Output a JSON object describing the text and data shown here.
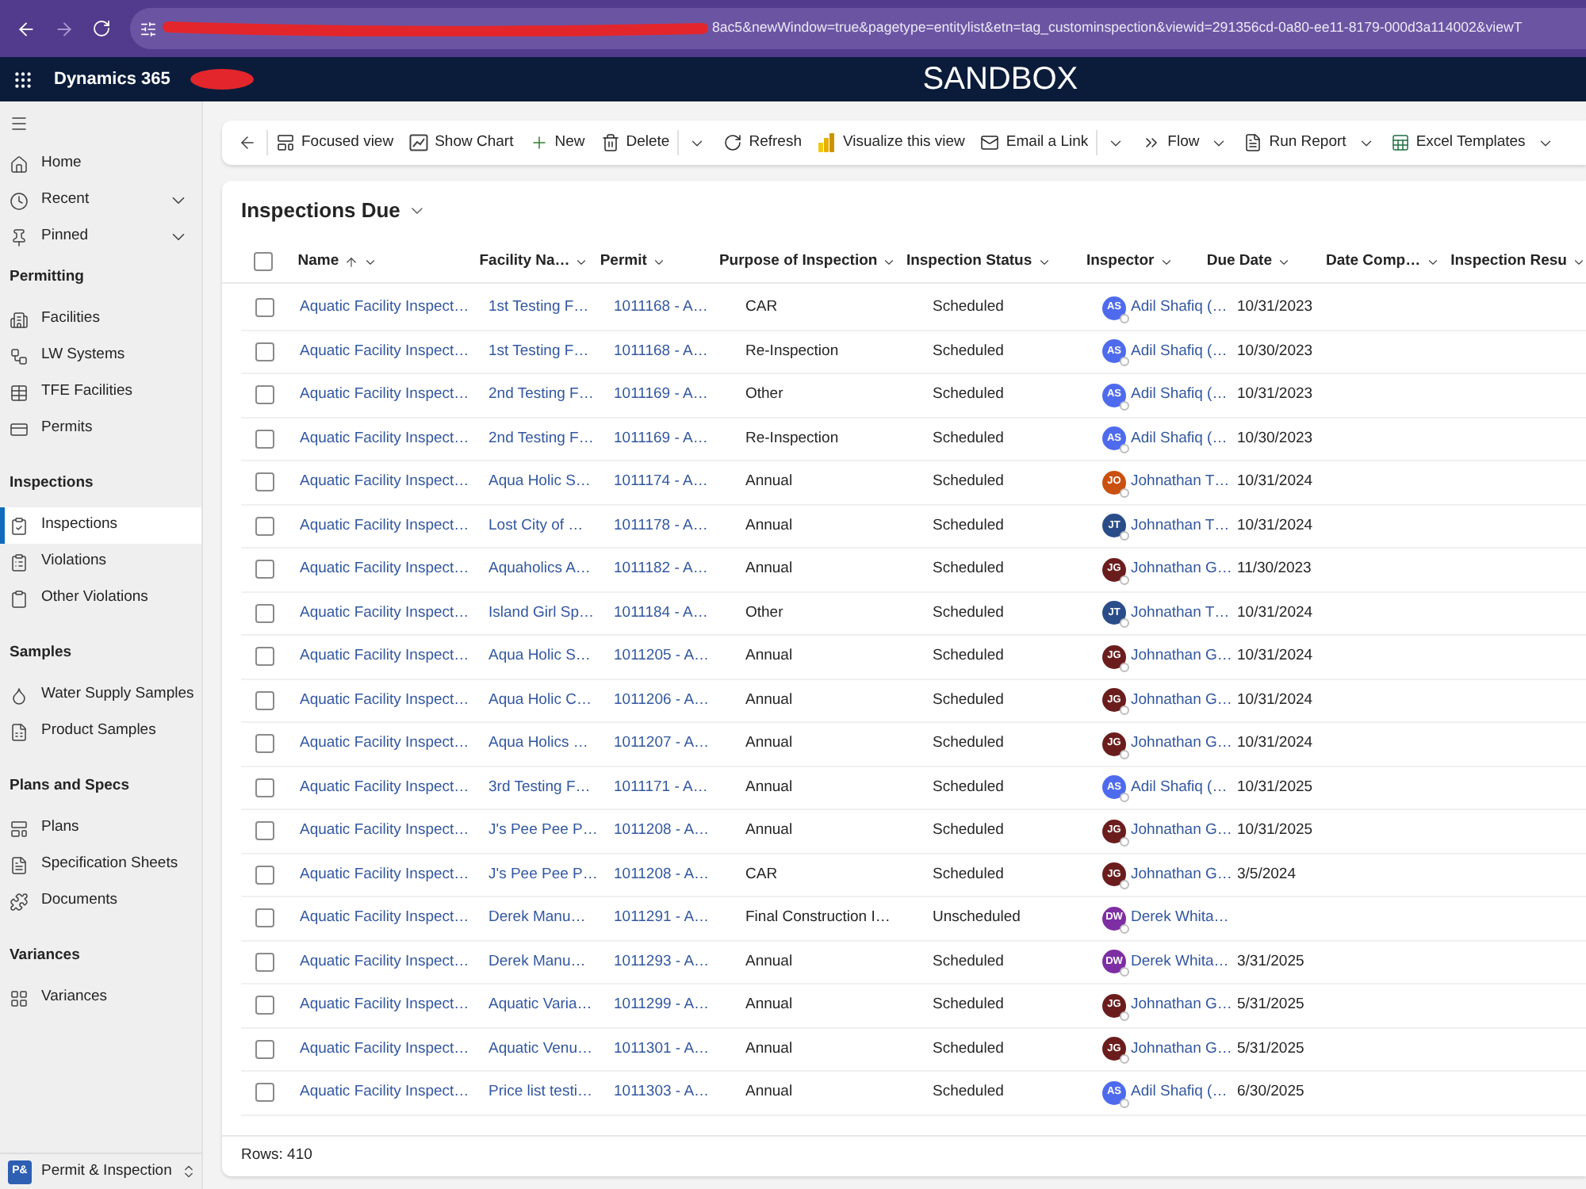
{
  "browser": {
    "url": "8ac5&newWindow=true&pagetype=entitylist&etn=tag_custominspection&viewid=291356cd-0a80-ee11-8179-000d3a114002&viewT"
  },
  "app_header": {
    "app_name": "Dynamics 365",
    "banner": "SANDBOX"
  },
  "sidebar": {
    "top_items": [
      {
        "label": "Home",
        "expandable": false,
        "selected": false
      },
      {
        "label": "Recent",
        "expandable": true,
        "selected": false
      },
      {
        "label": "Pinned",
        "expandable": true,
        "selected": false
      }
    ],
    "sections": [
      {
        "title": "Permitting",
        "items": [
          {
            "label": "Facilities",
            "selected": false
          },
          {
            "label": "LW Systems",
            "selected": false
          },
          {
            "label": "TFE Facilities",
            "selected": false
          },
          {
            "label": "Permits",
            "selected": false
          }
        ]
      },
      {
        "title": "Inspections",
        "items": [
          {
            "label": "Inspections",
            "selected": true
          },
          {
            "label": "Violations",
            "selected": false
          },
          {
            "label": "Other Violations",
            "selected": false
          }
        ]
      },
      {
        "title": "Samples",
        "items": [
          {
            "label": "Water Supply Samples",
            "selected": false
          },
          {
            "label": "Product Samples",
            "selected": false
          }
        ]
      },
      {
        "title": "Plans and Specs",
        "items": [
          {
            "label": "Plans",
            "selected": false
          },
          {
            "label": "Specification Sheets",
            "selected": false
          },
          {
            "label": "Documents",
            "selected": false
          }
        ]
      },
      {
        "title": "Variances",
        "items": [
          {
            "label": "Variances",
            "selected": false
          }
        ]
      }
    ],
    "app_switcher": {
      "badge": "P&",
      "label": "Permit & Inspection"
    }
  },
  "toolbar": {
    "items": [
      {
        "kind": "back"
      },
      {
        "kind": "button",
        "label": "Focused view"
      },
      {
        "kind": "button",
        "label": "Show Chart"
      },
      {
        "kind": "button",
        "label": "New"
      },
      {
        "kind": "button",
        "label": "Delete"
      },
      {
        "kind": "more"
      },
      {
        "kind": "button",
        "label": "Refresh"
      },
      {
        "kind": "button",
        "label": "Visualize this view"
      },
      {
        "kind": "button",
        "label": "Email a Link"
      },
      {
        "kind": "more"
      },
      {
        "kind": "menu",
        "label": "Flow"
      },
      {
        "kind": "menu",
        "label": "Run Report"
      },
      {
        "kind": "menu",
        "label": "Excel Templates"
      }
    ]
  },
  "grid": {
    "title": "Inspections Due",
    "select_all_checked": false,
    "columns": [
      {
        "label": "Name",
        "sorted": true
      },
      {
        "label": "Facility Na…",
        "sorted": false
      },
      {
        "label": "Permit",
        "sorted": false
      },
      {
        "label": "Purpose of Inspection",
        "sorted": false
      },
      {
        "label": "Inspection Status",
        "sorted": false
      },
      {
        "label": "Inspector",
        "sorted": false
      },
      {
        "label": "Due Date",
        "sorted": false
      },
      {
        "label": "Date Comp…",
        "sorted": false
      },
      {
        "label": "Inspection Resu",
        "sorted": false
      }
    ],
    "rows": [
      {
        "selected": false,
        "name": "Aquatic Facility Inspect…",
        "facility": "1st Testing F…",
        "permit": "1011168 - A…",
        "purpose": "CAR",
        "status": "Scheduled",
        "inspector": {
          "initials": "AS",
          "name": "Adil Shafiq (…",
          "color": "#4f6bed"
        },
        "due_date": "10/31/2023"
      },
      {
        "selected": false,
        "name": "Aquatic Facility Inspect…",
        "facility": "1st Testing F…",
        "permit": "1011168 - A…",
        "purpose": "Re-Inspection",
        "status": "Scheduled",
        "inspector": {
          "initials": "AS",
          "name": "Adil Shafiq (…",
          "color": "#4f6bed"
        },
        "due_date": "10/30/2023"
      },
      {
        "selected": false,
        "name": "Aquatic Facility Inspect…",
        "facility": "2nd Testing F…",
        "permit": "1011169 - A…",
        "purpose": "Other",
        "status": "Scheduled",
        "inspector": {
          "initials": "AS",
          "name": "Adil Shafiq (…",
          "color": "#4f6bed"
        },
        "due_date": "10/31/2023"
      },
      {
        "selected": false,
        "name": "Aquatic Facility Inspect…",
        "facility": "2nd Testing F…",
        "permit": "1011169 - A…",
        "purpose": "Re-Inspection",
        "status": "Scheduled",
        "inspector": {
          "initials": "AS",
          "name": "Adil Shafiq (…",
          "color": "#4f6bed"
        },
        "due_date": "10/30/2023"
      },
      {
        "selected": false,
        "name": "Aquatic Facility Inspect…",
        "facility": "Aqua Holic S…",
        "permit": "1011174 - A…",
        "purpose": "Annual",
        "status": "Scheduled",
        "inspector": {
          "initials": "JO",
          "name": "Johnathan T…",
          "color": "#ca5010"
        },
        "due_date": "10/31/2024"
      },
      {
        "selected": false,
        "name": "Aquatic Facility Inspect…",
        "facility": "Lost City of …",
        "permit": "1011178 - A…",
        "purpose": "Annual",
        "status": "Scheduled",
        "inspector": {
          "initials": "JT",
          "name": "Johnathan T…",
          "color": "#2a4d8a"
        },
        "due_date": "10/31/2024"
      },
      {
        "selected": false,
        "name": "Aquatic Facility Inspect…",
        "facility": "Aquaholics A…",
        "permit": "1011182 - A…",
        "purpose": "Annual",
        "status": "Scheduled",
        "inspector": {
          "initials": "JG",
          "name": "Johnathan G…",
          "color": "#6b1d1d"
        },
        "due_date": "11/30/2023"
      },
      {
        "selected": false,
        "name": "Aquatic Facility Inspect…",
        "facility": "Island Girl Sp…",
        "permit": "1011184 - A…",
        "purpose": "Other",
        "status": "Scheduled",
        "inspector": {
          "initials": "JT",
          "name": "Johnathan T…",
          "color": "#2a4d8a"
        },
        "due_date": "10/31/2024"
      },
      {
        "selected": false,
        "name": "Aquatic Facility Inspect…",
        "facility": "Aqua Holic S…",
        "permit": "1011205 - A…",
        "purpose": "Annual",
        "status": "Scheduled",
        "inspector": {
          "initials": "JG",
          "name": "Johnathan G…",
          "color": "#6b1d1d"
        },
        "due_date": "10/31/2024"
      },
      {
        "selected": false,
        "name": "Aquatic Facility Inspect…",
        "facility": "Aqua Holic C…",
        "permit": "1011206 - A…",
        "purpose": "Annual",
        "status": "Scheduled",
        "inspector": {
          "initials": "JG",
          "name": "Johnathan G…",
          "color": "#6b1d1d"
        },
        "due_date": "10/31/2024"
      },
      {
        "selected": false,
        "name": "Aquatic Facility Inspect…",
        "facility": "Aqua Holics …",
        "permit": "1011207 - A…",
        "purpose": "Annual",
        "status": "Scheduled",
        "inspector": {
          "initials": "JG",
          "name": "Johnathan G…",
          "color": "#6b1d1d"
        },
        "due_date": "10/31/2024"
      },
      {
        "selected": false,
        "name": "Aquatic Facility Inspect…",
        "facility": "3rd Testing F…",
        "permit": "1011171 - A…",
        "purpose": "Annual",
        "status": "Scheduled",
        "inspector": {
          "initials": "AS",
          "name": "Adil Shafiq (…",
          "color": "#4f6bed"
        },
        "due_date": "10/31/2025"
      },
      {
        "selected": false,
        "name": "Aquatic Facility Inspect…",
        "facility": "J's Pee Pee P…",
        "permit": "1011208 - A…",
        "purpose": "Annual",
        "status": "Scheduled",
        "inspector": {
          "initials": "JG",
          "name": "Johnathan G…",
          "color": "#6b1d1d"
        },
        "due_date": "10/31/2025"
      },
      {
        "selected": false,
        "name": "Aquatic Facility Inspect…",
        "facility": "J's Pee Pee P…",
        "permit": "1011208 - A…",
        "purpose": "CAR",
        "status": "Scheduled",
        "inspector": {
          "initials": "JG",
          "name": "Johnathan G…",
          "color": "#6b1d1d"
        },
        "due_date": "3/5/2024"
      },
      {
        "selected": false,
        "name": "Aquatic Facility Inspect…",
        "facility": "Derek Manu…",
        "permit": "1011291 - A…",
        "purpose": "Final Construction I…",
        "status": "Unscheduled",
        "inspector": {
          "initials": "DW",
          "name": "Derek Whita…",
          "color": "#7e2ea3"
        }
      },
      {
        "selected": false,
        "name": "Aquatic Facility Inspect…",
        "facility": "Derek Manu…",
        "permit": "1011293 - A…",
        "purpose": "Annual",
        "status": "Scheduled",
        "inspector": {
          "initials": "DW",
          "name": "Derek Whita…",
          "color": "#7e2ea3"
        },
        "due_date": "3/31/2025"
      },
      {
        "selected": false,
        "name": "Aquatic Facility Inspect…",
        "facility": "Aquatic Varia…",
        "permit": "1011299 - A…",
        "purpose": "Annual",
        "status": "Scheduled",
        "inspector": {
          "initials": "JG",
          "name": "Johnathan G…",
          "color": "#6b1d1d"
        },
        "due_date": "5/31/2025"
      },
      {
        "selected": false,
        "name": "Aquatic Facility Inspect…",
        "facility": "Aquatic Venu…",
        "permit": "1011301 - A…",
        "purpose": "Annual",
        "status": "Scheduled",
        "inspector": {
          "initials": "JG",
          "name": "Johnathan G…",
          "color": "#6b1d1d"
        },
        "due_date": "5/31/2025"
      },
      {
        "selected": false,
        "name": "Aquatic Facility Inspect…",
        "facility": "Price list testi…",
        "permit": "1011303 - A…",
        "purpose": "Annual",
        "status": "Scheduled",
        "inspector": {
          "initials": "AS",
          "name": "Adil Shafiq (…",
          "color": "#4f6bed"
        },
        "due_date": "6/30/2025"
      }
    ],
    "footer": "Rows: 410"
  }
}
